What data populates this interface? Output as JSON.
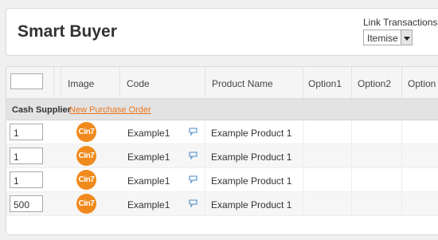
{
  "header": {
    "title": "Smart Buyer",
    "link_label": "Link Transactions",
    "link_select_value": "Itemise"
  },
  "table": {
    "columns": [
      "Image",
      "Code",
      "Product Name",
      "Option1",
      "Option2",
      "Option"
    ],
    "filter_value": "",
    "group": {
      "label": "Cash Supplier",
      "link": "New Purchase Order"
    },
    "rows": [
      {
        "qty": "1",
        "logo": "Cin7",
        "code": "Example1",
        "product": "Example Product 1",
        "comment_icon": "comment-icon"
      },
      {
        "qty": "1",
        "logo": "Cin7",
        "code": "Example1",
        "product": "Example Product 1",
        "comment_icon": "comment-icon"
      },
      {
        "qty": "1",
        "logo": "Cin7",
        "code": "Example1",
        "product": "Example Product 1",
        "comment_icon": "comment-icon"
      },
      {
        "qty": "500",
        "logo": "Cin7",
        "code": "Example1",
        "product": "Example Product 1",
        "comment_icon": "comment-icon"
      }
    ]
  },
  "colors": {
    "accent": "#e87722",
    "logo": "#f08a1c",
    "comment_icon": "#4a8ec9"
  }
}
